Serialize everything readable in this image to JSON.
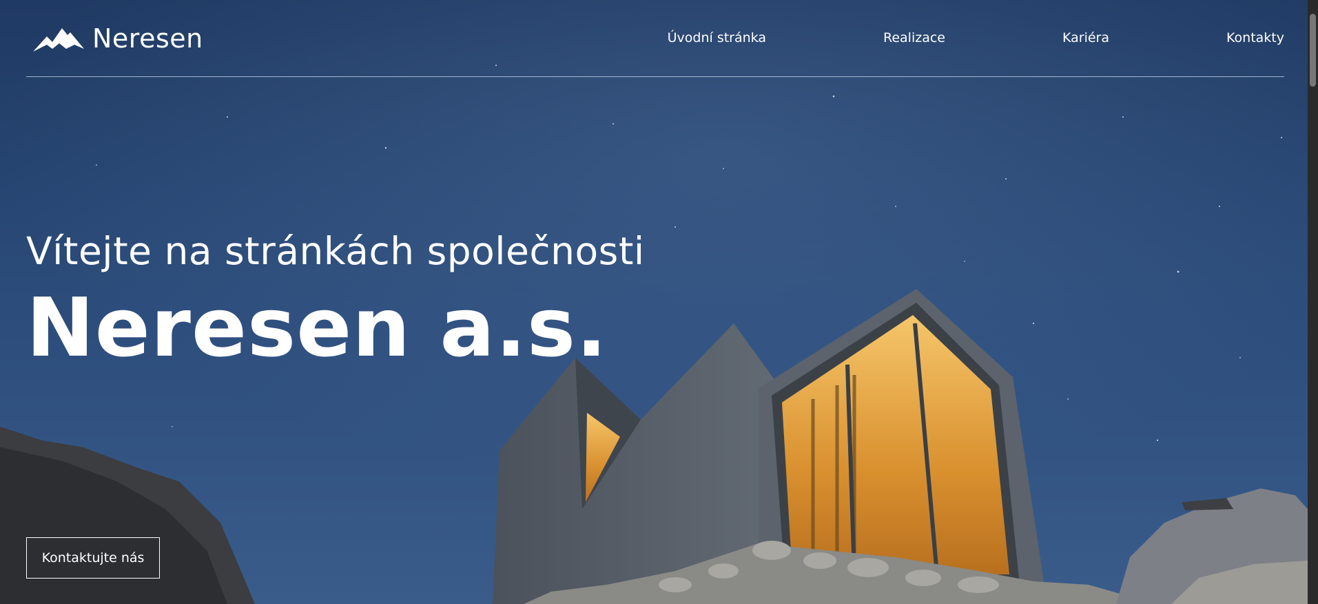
{
  "brand": {
    "logo_icon": "mountain-icon",
    "name": "Neresen"
  },
  "nav": {
    "items": [
      {
        "label": "Úvodní stránka"
      },
      {
        "label": "Realizace"
      },
      {
        "label": "Kariéra"
      },
      {
        "label": "Kontakty"
      }
    ]
  },
  "hero": {
    "welcome": "Vítejte na stránkách společnosti",
    "company": "Neresen a.s.",
    "cta_label": "Kontaktujte nás",
    "image_subject": "mountain cabin at night under starry sky"
  },
  "colors": {
    "sky_top": "#2a4a76",
    "sky_bottom": "#3b5a86",
    "text": "#ffffff",
    "window_glow": "#e2a03a"
  }
}
